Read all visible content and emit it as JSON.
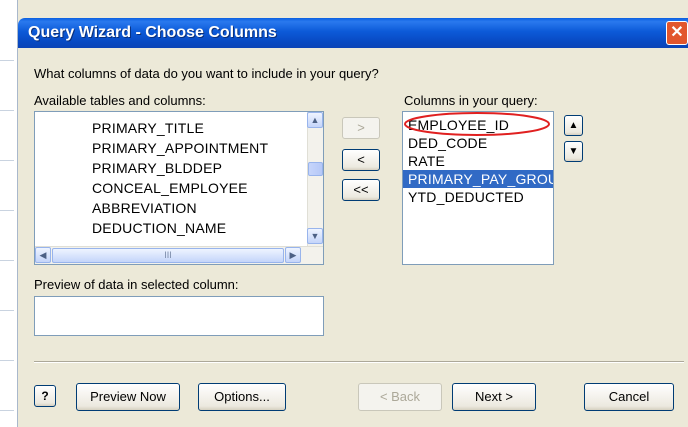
{
  "window": {
    "title": "Query Wizard - Choose Columns",
    "close_glyph": "✕"
  },
  "prompt": "What columns of data do you want to include in your query?",
  "available": {
    "label": "Available tables and columns:",
    "items": [
      "PRIMARY_TITLE",
      "PRIMARY_APPOINTMENT",
      "PRIMARY_BLDDEP",
      "CONCEAL_EMPLOYEE",
      "ABBREVIATION",
      "DEDUCTION_NAME"
    ],
    "hscroll_grip": "III"
  },
  "transfer": {
    "add": ">",
    "remove": "<",
    "remove_all": "<<"
  },
  "selected": {
    "label": "Columns in your query:",
    "items": [
      "EMPLOYEE_ID",
      "DED_CODE",
      "RATE",
      "PRIMARY_PAY_GROUP",
      "YTD_DEDUCTED"
    ],
    "selected_index": 3,
    "highlight_color": "#316ac5",
    "annotation_color": "#e02020"
  },
  "reorder": {
    "up": "▲",
    "down": "▼"
  },
  "preview": {
    "label": "Preview of data in selected column:",
    "value": ""
  },
  "footer": {
    "help_glyph": "?",
    "preview_now": "Preview Now",
    "options": "Options...",
    "back": "< Back",
    "next": "Next >",
    "cancel": "Cancel"
  }
}
